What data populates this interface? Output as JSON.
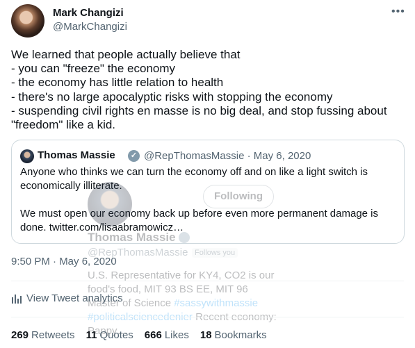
{
  "author": {
    "name": "Mark Changizi",
    "handle": "@MarkChangizi"
  },
  "tweet": {
    "text": "We learned that people actually believe that\n- you can \"freeze\" the economy\n- the economy has little relation to health\n- there's no large apocalyptic risks with stopping the economy\n- suspending civil rights en masse is no big deal, and stop fussing about \"freedom\" like a kid.",
    "timestamp": "9:50 PM · May 6, 2020"
  },
  "quote": {
    "name": "Thomas Massie",
    "meta": "@RepThomasMassie · May 6, 2020",
    "text": "Anyone who thinks we can turn the economy off and on like a light switch is economically illiterate.\n\nWe must open our economy back up before even more permanent damage is done. twitter.com/lisaabramowicz…"
  },
  "hover_card": {
    "follow_label": "Following",
    "name": "Thomas Massie",
    "handle": "@RepThomasMassie",
    "follows_you": "Follows you",
    "bio_plain": "U.S. Representative for KY4, CO2 is our food's food, MIT 93 BS EE, MIT 96 Master of Science ",
    "bio_tag1": "#sassywithmassie",
    "bio_tag2": "#politicalsciencedenier",
    "bio_tail": " Recent economy: Pappy…"
  },
  "analytics_label": "View Tweet analytics",
  "stats": {
    "retweets_count": "269",
    "retweets_label": "Retweets",
    "quotes_count": "11",
    "quotes_label": "Quotes",
    "likes_count": "666",
    "likes_label": "Likes",
    "bookmarks_count": "18",
    "bookmarks_label": "Bookmarks"
  },
  "icons": [
    "more-icon",
    "verified-badge-icon",
    "analytics-icon"
  ],
  "colors": {
    "text": "#0f1419",
    "secondary": "#536471",
    "link": "#1d9bf0",
    "border": "#cfd9de"
  }
}
